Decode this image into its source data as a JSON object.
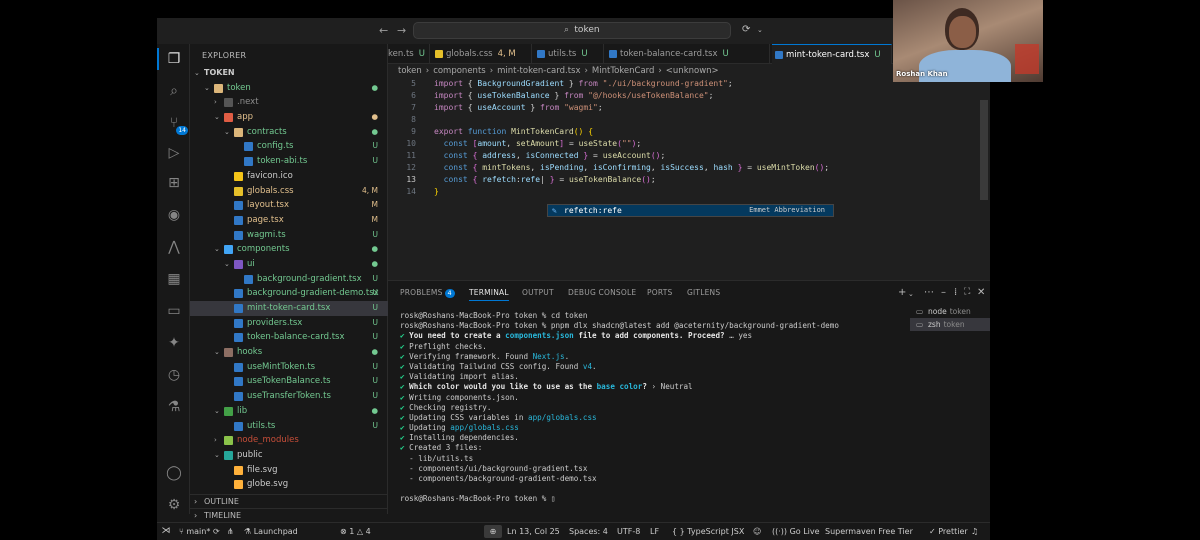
{
  "titlebar": {
    "search": "token"
  },
  "sidebar": {
    "title": "EXPLORER",
    "tree": [
      {
        "name": "TOKEN",
        "depth": 0,
        "kind": "root",
        "chev": "⌄",
        "status": "",
        "scls": "c-def"
      },
      {
        "name": "token",
        "depth": 1,
        "kind": "f-folder",
        "chev": "⌄",
        "status": "●",
        "ncls": "c-unt",
        "scls": "c-unt"
      },
      {
        "name": ".next",
        "depth": 2,
        "kind": "f-next",
        "chev": "›",
        "status": "",
        "ncls": "c-ign",
        "scls": "c-ign"
      },
      {
        "name": "app",
        "depth": 2,
        "kind": "f-app",
        "chev": "⌄",
        "status": "●",
        "ncls": "c-mod",
        "scls": "c-mod"
      },
      {
        "name": "contracts",
        "depth": 3,
        "kind": "f-folder",
        "chev": "⌄",
        "status": "●",
        "ncls": "c-unt",
        "scls": "c-unt"
      },
      {
        "name": "config.ts",
        "depth": 4,
        "kind": "f-ts",
        "chev": "",
        "status": "U",
        "ncls": "c-unt",
        "scls": "c-unt"
      },
      {
        "name": "token-abi.ts",
        "depth": 4,
        "kind": "f-ts",
        "chev": "",
        "status": "U",
        "ncls": "c-unt",
        "scls": "c-unt"
      },
      {
        "name": "favicon.ico",
        "depth": 3,
        "kind": "f-ico",
        "chev": "",
        "status": "",
        "ncls": "c-def",
        "scls": "c-def"
      },
      {
        "name": "globals.css",
        "depth": 3,
        "kind": "f-css",
        "chev": "",
        "status": "4, M",
        "ncls": "c-mod",
        "scls": "c-mod"
      },
      {
        "name": "layout.tsx",
        "depth": 3,
        "kind": "f-tsx",
        "chev": "",
        "status": "M",
        "ncls": "c-mod",
        "scls": "c-mod"
      },
      {
        "name": "page.tsx",
        "depth": 3,
        "kind": "f-tsx",
        "chev": "",
        "status": "M",
        "ncls": "c-mod",
        "scls": "c-mod"
      },
      {
        "name": "wagmi.ts",
        "depth": 3,
        "kind": "f-ts",
        "chev": "",
        "status": "U",
        "ncls": "c-unt",
        "scls": "c-unt"
      },
      {
        "name": "components",
        "depth": 2,
        "kind": "f-comp",
        "chev": "⌄",
        "status": "●",
        "ncls": "c-unt",
        "scls": "c-unt"
      },
      {
        "name": "ui",
        "depth": 3,
        "kind": "f-ui",
        "chev": "⌄",
        "status": "●",
        "ncls": "c-unt",
        "scls": "c-unt"
      },
      {
        "name": "background-gradient.tsx",
        "depth": 4,
        "kind": "f-tsx",
        "chev": "",
        "status": "U",
        "ncls": "c-unt",
        "scls": "c-unt"
      },
      {
        "name": "background-gradient-demo.tsx",
        "depth": 3,
        "kind": "f-tsx",
        "chev": "",
        "status": "U",
        "ncls": "c-unt",
        "scls": "c-unt"
      },
      {
        "name": "mint-token-card.tsx",
        "depth": 3,
        "kind": "f-tsx",
        "chev": "",
        "status": "U",
        "ncls": "c-unt",
        "scls": "c-unt",
        "selected": true
      },
      {
        "name": "providers.tsx",
        "depth": 3,
        "kind": "f-tsx",
        "chev": "",
        "status": "U",
        "ncls": "c-unt",
        "scls": "c-unt"
      },
      {
        "name": "token-balance-card.tsx",
        "depth": 3,
        "kind": "f-tsx",
        "chev": "",
        "status": "U",
        "ncls": "c-unt",
        "scls": "c-unt"
      },
      {
        "name": "hooks",
        "depth": 2,
        "kind": "f-hooks",
        "chev": "⌄",
        "status": "●",
        "ncls": "c-unt",
        "scls": "c-unt"
      },
      {
        "name": "useMintToken.ts",
        "depth": 3,
        "kind": "f-ts",
        "chev": "",
        "status": "U",
        "ncls": "c-unt",
        "scls": "c-unt"
      },
      {
        "name": "useTokenBalance.ts",
        "depth": 3,
        "kind": "f-ts",
        "chev": "",
        "status": "U",
        "ncls": "c-unt",
        "scls": "c-unt"
      },
      {
        "name": "useTransferToken.ts",
        "depth": 3,
        "kind": "f-ts",
        "chev": "",
        "status": "U",
        "ncls": "c-unt",
        "scls": "c-unt"
      },
      {
        "name": "lib",
        "depth": 2,
        "kind": "f-lib",
        "chev": "⌄",
        "status": "●",
        "ncls": "c-unt",
        "scls": "c-unt"
      },
      {
        "name": "utils.ts",
        "depth": 3,
        "kind": "f-ts",
        "chev": "",
        "status": "U",
        "ncls": "c-unt",
        "scls": "c-unt"
      },
      {
        "name": "node_modules",
        "depth": 2,
        "kind": "f-nm",
        "chev": "›",
        "status": "",
        "ncls": "c-red",
        "scls": "c-red"
      },
      {
        "name": "public",
        "depth": 2,
        "kind": "f-pub",
        "chev": "⌄",
        "status": "",
        "ncls": "c-def",
        "scls": "c-def"
      },
      {
        "name": "file.svg",
        "depth": 3,
        "kind": "f-svg",
        "chev": "",
        "status": "",
        "ncls": "c-def",
        "scls": "c-def"
      },
      {
        "name": "globe.svg",
        "depth": 3,
        "kind": "f-svg",
        "chev": "",
        "status": "",
        "ncls": "c-def",
        "scls": "c-def"
      }
    ],
    "outline": "OUTLINE",
    "timeline": "TIMELINE"
  },
  "editor": {
    "tabs": [
      {
        "label": "ken.ts",
        "status": "U",
        "color": "#3178c6",
        "m": false
      },
      {
        "label": "globals.css",
        "status": "4, M",
        "color": "#e6c02a",
        "m": true
      },
      {
        "label": "utils.ts",
        "status": "U",
        "color": "#3178c6",
        "m": false
      },
      {
        "label": "token-balance-card.tsx",
        "status": "U",
        "color": "#3178c6",
        "m": false
      },
      {
        "label": "mint-token-card.tsx",
        "status": "U",
        "color": "#3178c6",
        "m": false,
        "active": true
      }
    ],
    "breadcrumb": [
      "token",
      "›",
      "components",
      "›",
      "mint-token-card.tsx",
      "›",
      "MintTokenCard",
      "›",
      "<unknown>"
    ],
    "line_numbers": [
      "5",
      "6",
      "7",
      "8",
      "9",
      "10",
      "11",
      "12",
      "13",
      "14"
    ],
    "current_line": "13",
    "suggestion": {
      "label": "refetch:refe",
      "detail": "Emmet Abbreviation"
    }
  },
  "panel": {
    "tabs": [
      "PROBLEMS",
      "TERMINAL",
      "OUTPUT",
      "DEBUG CONSOLE",
      "PORTS",
      "GITLENS"
    ],
    "problems_count": "4",
    "active_tab": "TERMINAL",
    "terminal_lines": [
      "rosk@Roshans-MacBook-Pro token % cd token",
      "rosk@Roshans-MacBook-Pro token % pnpm dlx shadcn@latest add @aceternity/background-gradient-demo"
    ],
    "terminals": [
      {
        "name": "node",
        "sub": "token"
      },
      {
        "name": "zsh",
        "sub": "token",
        "selected": true
      }
    ],
    "prompt_end": "rosk@Roshans-MacBook-Pro token % "
  },
  "statusbar": {
    "branch": "main*",
    "launchpad": "Launchpad",
    "problems": "⊗ 1 △ 4",
    "position": "Ln 13, Col 25",
    "spaces": "Spaces: 4",
    "encoding": "UTF-8",
    "eol": "LF",
    "language": "TypeScript JSX",
    "golive": "Go Live",
    "supermaven": "Supermaven Free Tier",
    "prettier": "✓ Prettier"
  },
  "webcam": {
    "name": "Roshan Khan"
  }
}
